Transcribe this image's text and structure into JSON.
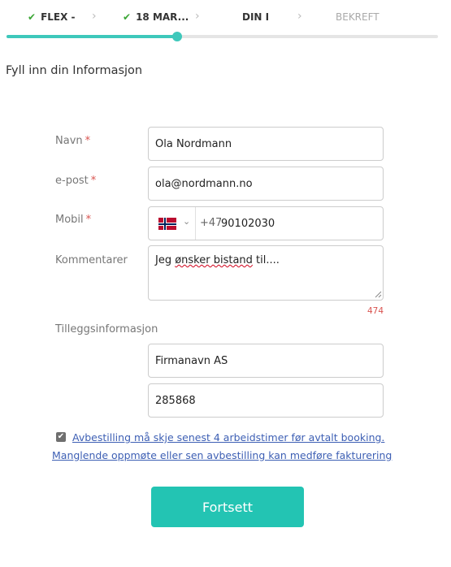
{
  "stepper": {
    "steps": [
      {
        "label": "FLEX -",
        "done": true
      },
      {
        "label": "18 MAR...",
        "done": true
      },
      {
        "label": "DIN I",
        "done": false
      },
      {
        "label": "BEKREFT",
        "done": false
      }
    ],
    "check_icon": "✔",
    "separator_icon": "›",
    "accent_color": "#3ec8bb"
  },
  "page_title": "Fyll inn din Informasjon",
  "form": {
    "required_mark": "*",
    "name": {
      "label": "Navn",
      "value": "Ola Nordmann"
    },
    "email": {
      "label": "e-post",
      "value": "ola@nordmann.no"
    },
    "phone": {
      "label": "Mobil",
      "country_icon": "norway-flag-icon",
      "dial_code": "+47",
      "value": "90102030",
      "chevron_icon": "⌄"
    },
    "comments": {
      "label": "Kommentarer",
      "value_prefix": "Jeg ",
      "value_misspelled": "ønsker bistand",
      "value_suffix": " til....",
      "remaining_chars": "474"
    },
    "extra": {
      "label": "Tilleggsinformasjon",
      "company": "Firmanavn AS",
      "number": "285868"
    },
    "terms": {
      "checked": true,
      "check_icon": "✔",
      "line1": "Avbestilling må skje senest 4 arbeidstimer før avtalt booking.",
      "line2": "Manglende oppmøte eller sen avbestilling kan medføre fakturering"
    }
  },
  "submit_label": "Fortsett",
  "colors": {
    "button": "#23c4b3",
    "link": "#3d5fb4",
    "required": "#d9534f"
  }
}
